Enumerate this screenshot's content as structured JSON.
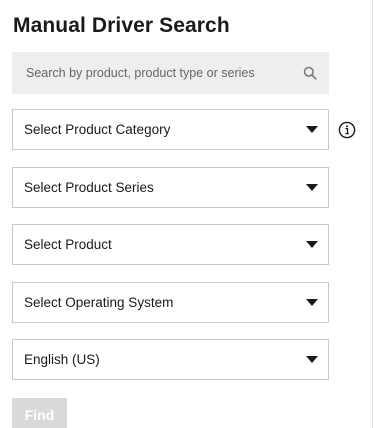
{
  "title": "Manual Driver Search",
  "search": {
    "placeholder": "Search by product, product type or series",
    "value": "",
    "icon": "search-icon"
  },
  "selects": [
    {
      "label": "Select Product Category",
      "icon": "chevron-down-icon",
      "info_icon": "info-icon"
    },
    {
      "label": "Select Product Series",
      "icon": "chevron-down-icon"
    },
    {
      "label": "Select Product",
      "icon": "chevron-down-icon"
    },
    {
      "label": "Select Operating System",
      "icon": "chevron-down-icon"
    },
    {
      "label": "English (US)",
      "icon": "chevron-down-icon"
    }
  ],
  "find_button": {
    "label": "Find",
    "disabled": true
  },
  "colors": {
    "search_background": "#eeeeee",
    "select_border": "#c9c9c9",
    "button_disabled_background": "#d9d9d9",
    "button_text": "#ffffff",
    "text": "#1a1a1a"
  }
}
